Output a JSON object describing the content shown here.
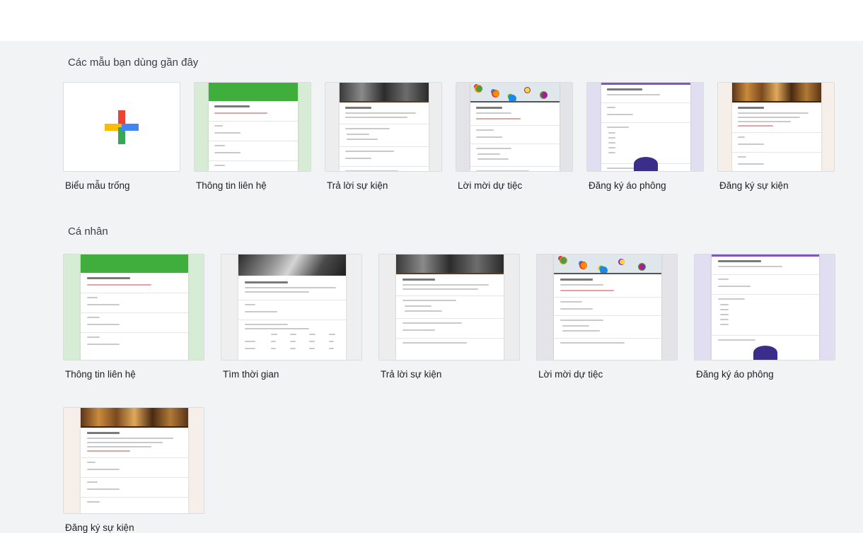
{
  "sections": {
    "recent": {
      "title": "Các mẫu bạn dùng gần đây",
      "templates": [
        {
          "label": "Biểu mẫu trống",
          "preview": "blank",
          "icon": "plus-icon"
        },
        {
          "label": "Thông tin liên hệ",
          "preview": "contact"
        },
        {
          "label": "Trả lời sự kiện",
          "preview": "rsvp"
        },
        {
          "label": "Lời mời dự tiệc",
          "preview": "party"
        },
        {
          "label": "Đăng ký áo phông",
          "preview": "tshirt"
        },
        {
          "label": "Đăng ký sự kiện",
          "preview": "event"
        }
      ]
    },
    "personal": {
      "title": "Cá nhân",
      "templates": [
        {
          "label": "Thông tin liên hệ",
          "preview": "contact"
        },
        {
          "label": "Tìm thời gian",
          "preview": "time"
        },
        {
          "label": "Trả lời sự kiện",
          "preview": "rsvp"
        },
        {
          "label": "Lời mời dự tiệc",
          "preview": "party"
        },
        {
          "label": "Đăng ký áo phông",
          "preview": "tshirt"
        },
        {
          "label": "Đăng ký sự kiện",
          "preview": "event"
        }
      ]
    }
  },
  "colors": {
    "contact_green": "#3fae3c",
    "contact_bg": "#d7ecd4",
    "tshirt_bg": "#e2def2",
    "party_bg": "#e4e4e8",
    "event_bg": "#f6eee8",
    "rsvp_bg": "#ededed",
    "time_bg": "#efefef",
    "event_brown": "#6b4220",
    "tshirt_purple": "#7e57c2"
  }
}
